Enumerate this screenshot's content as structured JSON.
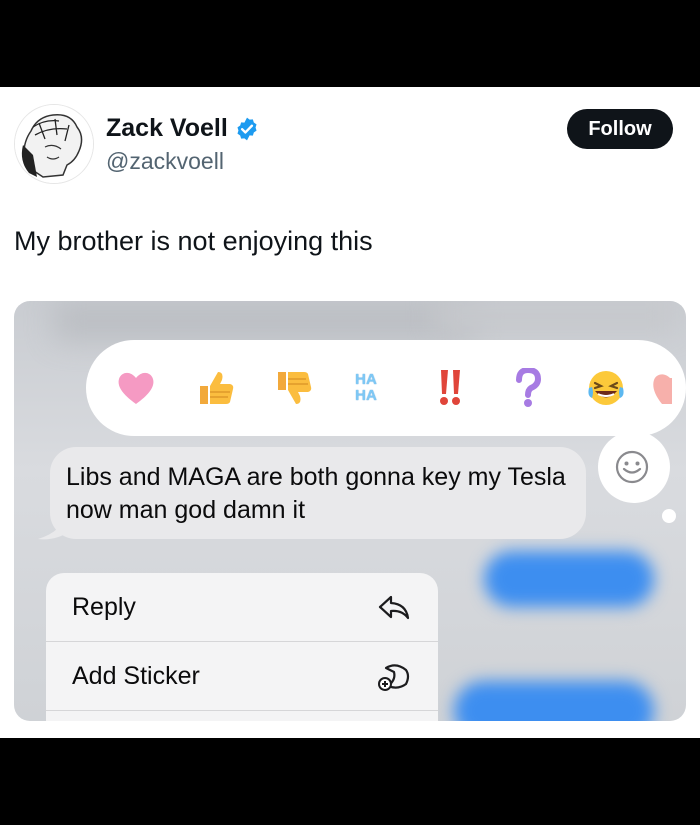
{
  "tweet": {
    "author_name": "Zack Voell",
    "handle": "@zackvoell",
    "follow_label": "Follow",
    "text": "My brother is not enjoying this"
  },
  "imessage": {
    "reactions": [
      "heart",
      "thumbs-up",
      "thumbs-down",
      "haha",
      "exclamation",
      "question",
      "laughing-face",
      "partial-heart"
    ],
    "haha_text": [
      "HA",
      "HA"
    ],
    "message_text": "Libs and MAGA are both gonna key my Tesla now man god damn it",
    "menu": [
      {
        "label": "Reply",
        "icon": "reply-icon"
      },
      {
        "label": "Add Sticker",
        "icon": "add-sticker-icon"
      }
    ]
  },
  "colors": {
    "verified": "#1d9bf0",
    "follow_bg": "#0f1419",
    "imessage_blue": "#3d8ef0",
    "bubble_gray": "#e9e9eb"
  }
}
